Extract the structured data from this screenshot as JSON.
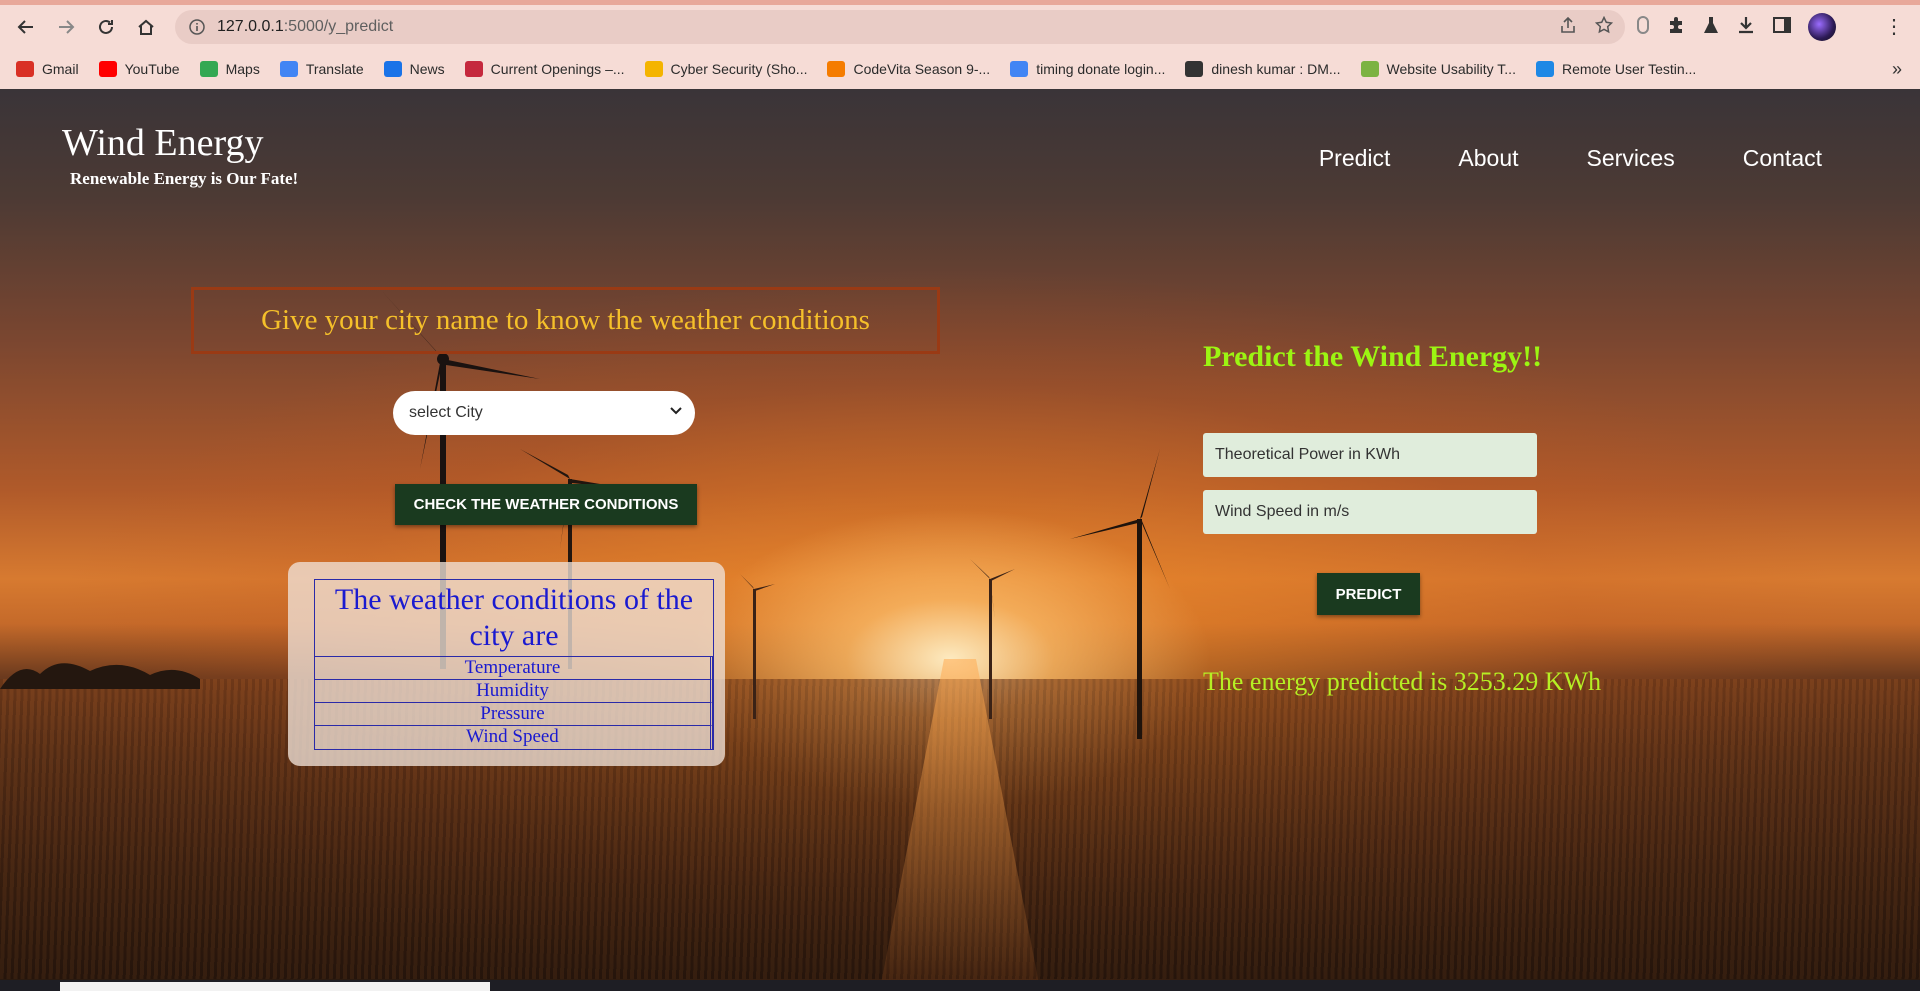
{
  "browser": {
    "url_host": "127.0.0.1",
    "url_path": ":5000/y_predict",
    "bookmarks": [
      {
        "label": "Gmail",
        "icon": "gmail-icon",
        "color": "#d93025"
      },
      {
        "label": "YouTube",
        "icon": "youtube-icon",
        "color": "#ff0000"
      },
      {
        "label": "Maps",
        "icon": "maps-icon",
        "color": "#34a853"
      },
      {
        "label": "Translate",
        "icon": "translate-icon",
        "color": "#4285f4"
      },
      {
        "label": "News",
        "icon": "news-icon",
        "color": "#1a73e8"
      },
      {
        "label": "Current Openings –...",
        "icon": "current-openings-icon",
        "color": "#c5283d"
      },
      {
        "label": "Cyber Security (Sho...",
        "icon": "shield-icon",
        "color": "#f4b400"
      },
      {
        "label": "CodeVita Season 9-...",
        "icon": "codevita-icon",
        "color": "#f57c00"
      },
      {
        "label": "timing donate login...",
        "icon": "google-icon",
        "color": "#4285f4"
      },
      {
        "label": "dinesh kumar : DM...",
        "icon": "globe-icon",
        "color": "#333333"
      },
      {
        "label": "Website Usability T...",
        "icon": "usability-icon",
        "color": "#7cb342"
      },
      {
        "label": "Remote User Testin...",
        "icon": "remote-testing-icon",
        "color": "#1e88e5"
      }
    ]
  },
  "site": {
    "brand_title": "Wind Energy",
    "brand_subtitle": "Renewable Energy is Our Fate!",
    "nav": [
      "Predict",
      "About",
      "Services",
      "Contact"
    ]
  },
  "weather": {
    "heading": "Give your city name to know the weather conditions",
    "select_value": "select City",
    "check_button": "CHECK THE WEATHER CONDITIONS",
    "table_heading": "The weather conditions of the city are",
    "rows": [
      "Temperature",
      "Humidity",
      "Pressure",
      "Wind Speed"
    ]
  },
  "predict": {
    "title": "Predict the Wind Energy!!",
    "power_placeholder": "Theoretical Power in KWh",
    "wind_placeholder": "Wind Speed in m/s",
    "button": "PREDICT",
    "result": "The energy predicted is 3253.29 KWh"
  },
  "colors": {
    "accent_green": "#9cf512",
    "heading_gold": "#f5c02a",
    "button_dark_green": "#1a3a1f",
    "table_blue": "#1a1ad0"
  }
}
